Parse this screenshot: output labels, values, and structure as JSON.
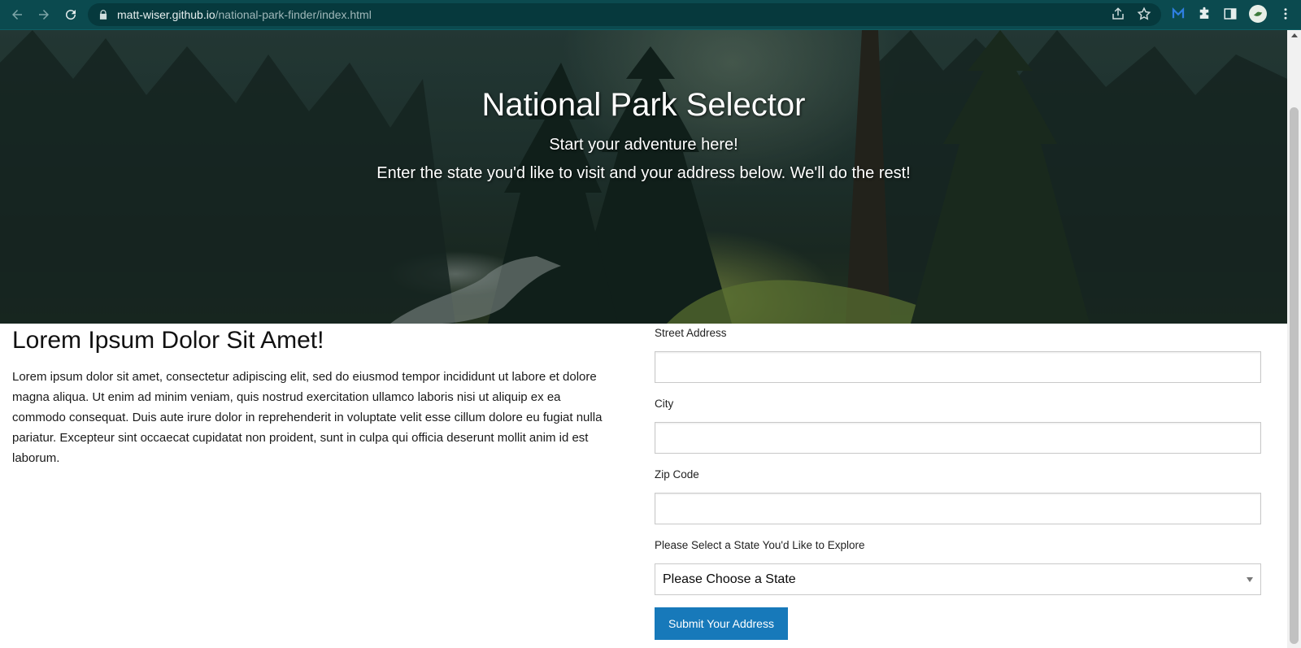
{
  "browser": {
    "url_host": "matt-wiser.github.io",
    "url_path": "/national-park-finder/index.html",
    "theme_color": "#0b4a4f"
  },
  "hero": {
    "title": "National Park Selector",
    "subtitle": "Start your adventure here!",
    "instructions": "Enter the state you'd like to visit and your address below. We'll do the rest!"
  },
  "intro": {
    "heading": "Lorem Ipsum Dolor Sit Amet!",
    "body": "Lorem ipsum dolor sit amet, consectetur adipiscing elit, sed do eiusmod tempor incididunt ut labore et dolore magna aliqua. Ut enim ad minim veniam, quis nostrud exercitation ullamco laboris nisi ut aliquip ex ea commodo consequat. Duis aute irure dolor in reprehenderit in voluptate velit esse cillum dolore eu fugiat nulla pariatur. Excepteur sint occaecat cupidatat non proident, sunt in culpa qui officia deserunt mollit anim id est laborum."
  },
  "form": {
    "street_label": "Street Address",
    "street_value": "",
    "city_label": "City",
    "city_value": "",
    "zip_label": "Zip Code",
    "zip_value": "",
    "state_label": "Please Select a State You'd Like to Explore",
    "state_selected": "Please Choose a State",
    "submit_label": "Submit Your Address",
    "button_color": "#1779ba"
  }
}
